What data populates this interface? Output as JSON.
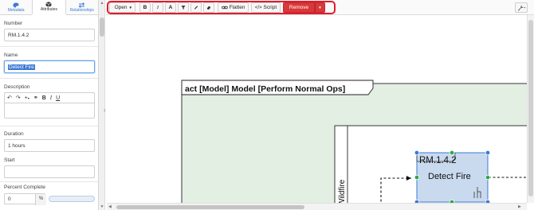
{
  "tabs": [
    {
      "label": "Metadata",
      "icon": "palette-icon"
    },
    {
      "label": "Attributes",
      "icon": "cube-icon"
    },
    {
      "label": "Relationships",
      "icon": "swap-arrows-icon"
    }
  ],
  "form": {
    "number_label": "Number",
    "number_value": "RM.1.4.2",
    "name_label": "Name",
    "name_value": "Detect Fire",
    "description_label": "Description",
    "duration_label": "Duration",
    "duration_value": "1 hours",
    "start_label": "Start",
    "start_value": "",
    "percent_label": "Percent Complete",
    "percent_value": "0",
    "percent_unit": "%",
    "percent_progress": 0
  },
  "rte_tools": {
    "undo": "↶",
    "redo": "↷",
    "add": "+",
    "add_caret": "▾",
    "link": "⚭",
    "bold": "B",
    "italic": "I",
    "underline": "U"
  },
  "toolbar": {
    "open_label": "Open",
    "bold": "B",
    "italic": "I",
    "font": "A",
    "flatten_label": "Flatten",
    "script_label": "Script",
    "remove_label": "Remove",
    "highlight_color": "#e21b2d",
    "remove_color": "#d9383a"
  },
  "diagram": {
    "frame_title": "act [Model] Model [Perform Normal Ops]",
    "swimlane_label": "Wildfire",
    "activity_number": "RM.1.4.2",
    "activity_name": "Detect Fire",
    "frame_fill": "#e3efe3",
    "activity_fill": "#c9d9ee",
    "selection_color": "#3a7bd5",
    "handle_color": "#2ea84a"
  }
}
